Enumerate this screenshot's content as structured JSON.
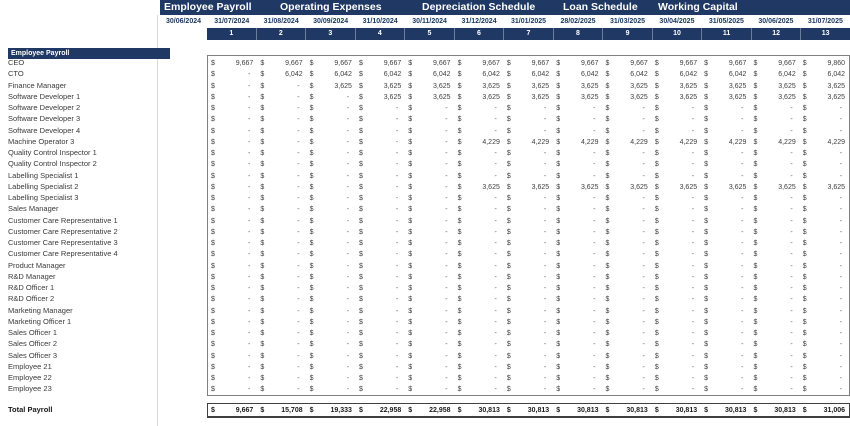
{
  "currency_symbol": "$",
  "colors": {
    "navy": "#1f3864",
    "grid_border": "#808080",
    "total_border": "#404040",
    "date_text": "#17365d"
  },
  "tabs": [
    {
      "label": "Employee Payroll"
    },
    {
      "label": "Operating Expenses"
    },
    {
      "label": "Depreciation Schedule"
    },
    {
      "label": "Loan Schedule"
    },
    {
      "label": "Working Capital"
    }
  ],
  "dates": [
    "30/06/2024",
    "31/07/2024",
    "31/08/2024",
    "30/09/2024",
    "31/10/2024",
    "30/11/2024",
    "31/12/2024",
    "31/01/2025",
    "28/02/2025",
    "31/03/2025",
    "30/04/2025",
    "31/05/2025",
    "30/06/2025",
    "31/07/2025"
  ],
  "periods": [
    "1",
    "2",
    "3",
    "4",
    "5",
    "6",
    "7",
    "8",
    "9",
    "10",
    "11",
    "12",
    "13"
  ],
  "section_header": "Employee Payroll",
  "rows": [
    {
      "label": "CEO",
      "values": [
        "9,667",
        "9,667",
        "9,667",
        "9,667",
        "9,667",
        "9,667",
        "9,667",
        "9,667",
        "9,667",
        "9,667",
        "9,667",
        "9,667",
        "9,860"
      ]
    },
    {
      "label": "CTO",
      "values": [
        "-",
        "6,042",
        "6,042",
        "6,042",
        "6,042",
        "6,042",
        "6,042",
        "6,042",
        "6,042",
        "6,042",
        "6,042",
        "6,042",
        "6,042"
      ]
    },
    {
      "label": "Finance Manager",
      "values": [
        "-",
        "-",
        "3,625",
        "3,625",
        "3,625",
        "3,625",
        "3,625",
        "3,625",
        "3,625",
        "3,625",
        "3,625",
        "3,625",
        "3,625"
      ]
    },
    {
      "label": "Software Developer 1",
      "values": [
        "-",
        "-",
        "-",
        "3,625",
        "3,625",
        "3,625",
        "3,625",
        "3,625",
        "3,625",
        "3,625",
        "3,625",
        "3,625",
        "3,625"
      ]
    },
    {
      "label": "Software Developer 2",
      "values": [
        "-",
        "-",
        "-",
        "-",
        "-",
        "-",
        "-",
        "-",
        "-",
        "-",
        "-",
        "-",
        "-"
      ]
    },
    {
      "label": "Software Developer 3",
      "values": [
        "-",
        "-",
        "-",
        "-",
        "-",
        "-",
        "-",
        "-",
        "-",
        "-",
        "-",
        "-",
        "-"
      ]
    },
    {
      "label": "Software Developer 4",
      "values": [
        "-",
        "-",
        "-",
        "-",
        "-",
        "-",
        "-",
        "-",
        "-",
        "-",
        "-",
        "-",
        "-"
      ]
    },
    {
      "label": "Machine Operator 3",
      "values": [
        "-",
        "-",
        "-",
        "-",
        "-",
        "4,229",
        "4,229",
        "4,229",
        "4,229",
        "4,229",
        "4,229",
        "4,229",
        "4,229"
      ]
    },
    {
      "label": "Quality Control Inspector 1",
      "values": [
        "-",
        "-",
        "-",
        "-",
        "-",
        "-",
        "-",
        "-",
        "-",
        "-",
        "-",
        "-",
        "-"
      ]
    },
    {
      "label": "Quality Control Inspector 2",
      "values": [
        "-",
        "-",
        "-",
        "-",
        "-",
        "-",
        "-",
        "-",
        "-",
        "-",
        "-",
        "-",
        "-"
      ]
    },
    {
      "label": "Labelling Specialist 1",
      "values": [
        "-",
        "-",
        "-",
        "-",
        "-",
        "-",
        "-",
        "-",
        "-",
        "-",
        "-",
        "-",
        "-"
      ]
    },
    {
      "label": "Labelling Specialist 2",
      "values": [
        "-",
        "-",
        "-",
        "-",
        "-",
        "3,625",
        "3,625",
        "3,625",
        "3,625",
        "3,625",
        "3,625",
        "3,625",
        "3,625"
      ]
    },
    {
      "label": "Labelling Specialist 3",
      "values": [
        "-",
        "-",
        "-",
        "-",
        "-",
        "-",
        "-",
        "-",
        "-",
        "-",
        "-",
        "-",
        "-"
      ]
    },
    {
      "label": "Sales Manager",
      "values": [
        "-",
        "-",
        "-",
        "-",
        "-",
        "-",
        "-",
        "-",
        "-",
        "-",
        "-",
        "-",
        "-"
      ]
    },
    {
      "label": "Customer Care Representative 1",
      "values": [
        "-",
        "-",
        "-",
        "-",
        "-",
        "-",
        "-",
        "-",
        "-",
        "-",
        "-",
        "-",
        "-"
      ]
    },
    {
      "label": "Customer Care Representative 2",
      "values": [
        "-",
        "-",
        "-",
        "-",
        "-",
        "-",
        "-",
        "-",
        "-",
        "-",
        "-",
        "-",
        "-"
      ]
    },
    {
      "label": "Customer Care Representative 3",
      "values": [
        "-",
        "-",
        "-",
        "-",
        "-",
        "-",
        "-",
        "-",
        "-",
        "-",
        "-",
        "-",
        "-"
      ]
    },
    {
      "label": "Customer Care Representative 4",
      "values": [
        "-",
        "-",
        "-",
        "-",
        "-",
        "-",
        "-",
        "-",
        "-",
        "-",
        "-",
        "-",
        "-"
      ]
    },
    {
      "label": "Product Manager",
      "values": [
        "-",
        "-",
        "-",
        "-",
        "-",
        "-",
        "-",
        "-",
        "-",
        "-",
        "-",
        "-",
        "-"
      ]
    },
    {
      "label": "R&D Manager",
      "values": [
        "-",
        "-",
        "-",
        "-",
        "-",
        "-",
        "-",
        "-",
        "-",
        "-",
        "-",
        "-",
        "-"
      ]
    },
    {
      "label": "R&D Officer 1",
      "values": [
        "-",
        "-",
        "-",
        "-",
        "-",
        "-",
        "-",
        "-",
        "-",
        "-",
        "-",
        "-",
        "-"
      ]
    },
    {
      "label": "R&D Officer 2",
      "values": [
        "-",
        "-",
        "-",
        "-",
        "-",
        "-",
        "-",
        "-",
        "-",
        "-",
        "-",
        "-",
        "-"
      ]
    },
    {
      "label": "Marketing Manager",
      "values": [
        "-",
        "-",
        "-",
        "-",
        "-",
        "-",
        "-",
        "-",
        "-",
        "-",
        "-",
        "-",
        "-"
      ]
    },
    {
      "label": "Marketing Officer 1",
      "values": [
        "-",
        "-",
        "-",
        "-",
        "-",
        "-",
        "-",
        "-",
        "-",
        "-",
        "-",
        "-",
        "-"
      ]
    },
    {
      "label": "Sales Officer 1",
      "values": [
        "-",
        "-",
        "-",
        "-",
        "-",
        "-",
        "-",
        "-",
        "-",
        "-",
        "-",
        "-",
        "-"
      ]
    },
    {
      "label": "Sales Officer 2",
      "values": [
        "-",
        "-",
        "-",
        "-",
        "-",
        "-",
        "-",
        "-",
        "-",
        "-",
        "-",
        "-",
        "-"
      ]
    },
    {
      "label": "Sales Officer 3",
      "values": [
        "-",
        "-",
        "-",
        "-",
        "-",
        "-",
        "-",
        "-",
        "-",
        "-",
        "-",
        "-",
        "-"
      ]
    },
    {
      "label": "Employee 21",
      "values": [
        "-",
        "-",
        "-",
        "-",
        "-",
        "-",
        "-",
        "-",
        "-",
        "-",
        "-",
        "-",
        "-"
      ]
    },
    {
      "label": "Employee 22",
      "values": [
        "-",
        "-",
        "-",
        "-",
        "-",
        "-",
        "-",
        "-",
        "-",
        "-",
        "-",
        "-",
        "-"
      ]
    },
    {
      "label": "Employee 23",
      "values": [
        "-",
        "-",
        "-",
        "-",
        "-",
        "-",
        "-",
        "-",
        "-",
        "-",
        "-",
        "-",
        "-"
      ]
    }
  ],
  "total": {
    "label": "Total Payroll",
    "values": [
      "9,667",
      "15,708",
      "19,333",
      "22,958",
      "22,958",
      "30,813",
      "30,813",
      "30,813",
      "30,813",
      "30,813",
      "30,813",
      "30,813",
      "31,006"
    ]
  }
}
